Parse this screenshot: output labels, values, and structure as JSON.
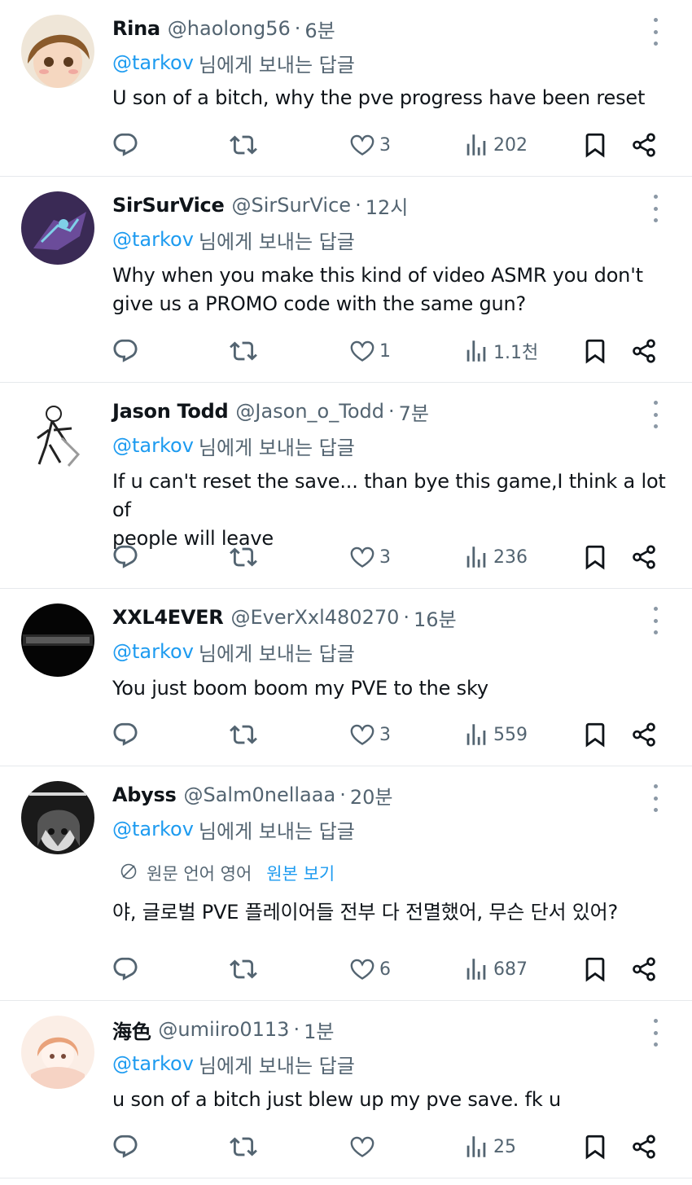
{
  "reply_prefix": "님에게 보내는 답글",
  "tweets": [
    {
      "name": "Rina",
      "handle": "@haolong56",
      "time": "6분",
      "mention": "@tarkov",
      "lines": [
        "U son of a bitch, why the pve progress have been reset"
      ],
      "likes": "3",
      "views": "202",
      "avatar_colors": {
        "bg": "#efe6d8",
        "a": "#8a5a2b",
        "b": "#f5d7c0"
      }
    },
    {
      "name": "SirSurVice",
      "handle": "@SirSurVice",
      "time": "12시",
      "mention": "@tarkov",
      "lines": [
        "Why when you make this kind of video ASMR you don't",
        "give us a PROMO code with the same gun?"
      ],
      "likes": "1",
      "views": "1.1천",
      "avatar_colors": {
        "bg": "#3a2a55",
        "a": "#6b4c9a",
        "b": "#7fd0e8"
      }
    },
    {
      "name": "Jason Todd",
      "handle": "@Jason_o_Todd",
      "time": "7분",
      "mention": "@tarkov",
      "lines": [
        "If u can't reset the save... than bye this game,I think a lot of",
        "people will leave"
      ],
      "likes": "3",
      "views": "236",
      "avatar_colors": {
        "bg": "#ffffff",
        "a": "#222222",
        "b": "#9a9a9a"
      }
    },
    {
      "name": "XXL4EVER",
      "handle": "@EverXxl480270",
      "time": "16분",
      "mention": "@tarkov",
      "lines": [
        "You just boom boom my PVE  to the sky"
      ],
      "likes": "3",
      "views": "559",
      "avatar_colors": {
        "bg": "#050505",
        "a": "#5a5a5a",
        "b": "#2a2a2a"
      }
    },
    {
      "name": "Abyss",
      "handle": "@Salm0nellaaa",
      "time": "20분",
      "mention": "@tarkov",
      "lines": [
        "야, 글로벌 PVE 플레이어들 전부 다 전멸했어, 무슨 단서 있어?"
      ],
      "translation": {
        "label": "원문 언어 영어",
        "link": "원본 보기"
      },
      "likes": "6",
      "views": "687",
      "avatar_colors": {
        "bg": "#1a1a1a",
        "a": "#d9d9d9",
        "b": "#555555"
      }
    },
    {
      "name": "海色",
      "handle": "@umiiro0113",
      "time": "1분",
      "mention": "@tarkov",
      "lines": [
        "u son of a bitch just blew up my pve save. fk u"
      ],
      "likes": "",
      "views": "25",
      "avatar_colors": {
        "bg": "#fbeee6",
        "a": "#e9a27a",
        "b": "#f6d3c4"
      }
    }
  ]
}
